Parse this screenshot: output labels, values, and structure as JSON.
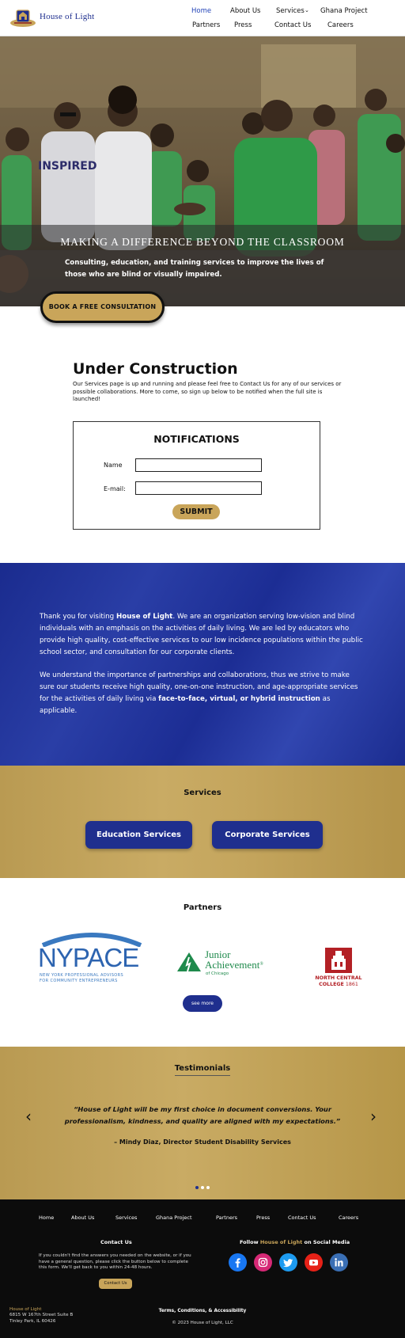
{
  "header": {
    "logo_text": "House of Light",
    "nav": [
      {
        "label": "Home",
        "active": true
      },
      {
        "label": "About Us"
      },
      {
        "label": "Services"
      },
      {
        "label": "Ghana Project"
      },
      {
        "label": "Partners"
      },
      {
        "label": "Press"
      },
      {
        "label": "Contact Us"
      },
      {
        "label": "Careers"
      }
    ]
  },
  "hero": {
    "title": "MAKING A DIFFERENCE BEYOND THE CLASSROOM",
    "subtitle": "Consulting, education, and training services to improve the lives of those who are blind or visually impaired.",
    "cta": "BOOK A FREE CONSULTATION",
    "shirt_text": "INSPIRED"
  },
  "construction": {
    "title": "Under Construction",
    "text": "Our Services page is up and running and please feel free to Contact Us for any of our services or possible collaborations. More to come, so sign up below to be notified when the full site is launched!",
    "form_title": "NOTIFICATIONS",
    "name_label": "Name",
    "email_label": "E-mail:",
    "name_value": "",
    "email_value": "",
    "submit_label": "SUBMIT"
  },
  "about": {
    "p1_before": "Thank you for visiting ",
    "p1_bold": "House of Light",
    "p1_after": ". We are an organization serving low-vision and blind individuals with an emphasis on the activities of daily living. We are led by educators who provide high quality, cost-effective services to our low incidence populations within the public school sector, and consultation for our corporate clients.",
    "p2_before": "We understand the importance of partnerships and collaborations, thus we strive to make sure our students receive high quality, one-on-one instruction, and age-appropriate services for the activities of daily living via ",
    "p2_bold": "face-to-face, virtual, or hybrid instruction",
    "p2_after": " as applicable."
  },
  "services": {
    "title": "Services",
    "buttons": [
      "Education Services",
      "Corporate Services"
    ]
  },
  "partners": {
    "title": "Partners",
    "nypace": {
      "big": "NYPACE",
      "line1": "NEW YORK PROFESSIONAL ADVISORS",
      "line2": "FOR COMMUNITY ENTREPRENEURS"
    },
    "ja": {
      "line1": "Junior",
      "line2": "Achievement",
      "reg": "®",
      "sub": "of Chicago"
    },
    "ncc": {
      "line1": "NORTH CENTRAL",
      "line2": "COLLEGE",
      "year": "1861"
    },
    "see_more": "see more"
  },
  "testimonials": {
    "title": "Testimonials",
    "quote": "“House of Light will be my first choice in document conversions. Your professionalism, kindness, and quality are aligned with my expectations.”",
    "author": "– Mindy Diaz, Director Student Disability Services",
    "prev": "‹",
    "next": "›",
    "slide_index": 1,
    "slide_count": 3
  },
  "footer": {
    "nav": [
      "Home",
      "About Us",
      "Services",
      "Ghana Project",
      "Partners",
      "Press",
      "Contact Us",
      "Careers"
    ],
    "contact_title": "Contact Us",
    "contact_text": "If you couldn't find the answers you needed on the website, or if you have a general question, please click the button below to complete this form.  We'll get back to you within 24-48 hours.",
    "contact_button": "Contact Us",
    "follow_before": "Follow ",
    "follow_brand": "House of Light",
    "follow_after": " on Social Media",
    "social": [
      "facebook-icon",
      "instagram-icon",
      "twitter-icon",
      "youtube-icon",
      "linkedin-icon"
    ],
    "address_name": "House of Light",
    "address_line1": "6815 W 167th Street Suite B",
    "address_line2": "Tinley Park, IL 60426",
    "terms": "Terms, Conditions, & Accessibility",
    "copyright": "© 2023 House of Light, LLC"
  },
  "colors": {
    "brand_blue": "#1f2f8e",
    "gold": "#c9a55a",
    "footer_bg": "#0c0c0c"
  }
}
